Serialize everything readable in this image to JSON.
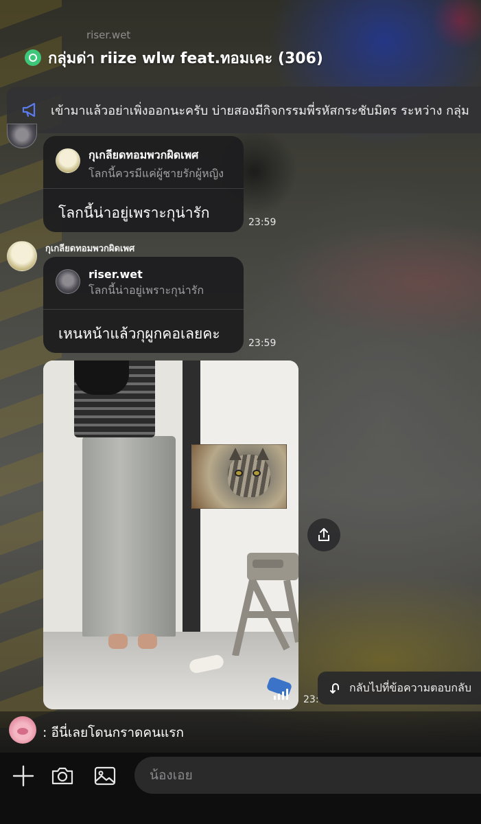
{
  "top_sender": "riser.wet",
  "header": {
    "title": "กลุ่มด่า riize wlw feat.ทอมเคะ (306)"
  },
  "announcement": {
    "text": "เข้ามาแล้วอย่าเพิ่งออกนะครับ บ่ายสองมีกิจกรรมพี่รหัสกระชับมิตร ระหว่าง กลุ่ม"
  },
  "messages": [
    {
      "reply_name": "กุเกลียดทอมพวกผิดเพศ",
      "reply_text": "โลกนี้ควรมีแค่ผู้ชายรักผู้หญิง",
      "text": "โลกนี้น่าอยู่เพราะกุน่ารัก",
      "time": "23:59"
    },
    {
      "sender": "กุเกลียดทอมพวกผิดเพศ",
      "reply_name": "riser.wet",
      "reply_text": "โลกนี้น่าอยู่เพราะกุน่ารัก",
      "text": "เหนหน้าแล้วกุผูกคอเลยคะ",
      "time": "23:59"
    }
  ],
  "media_time": "23:",
  "back_to_reply": {
    "label": "กลับไปที่ข้อความตอบกลับ"
  },
  "preview": {
    "text": ": อีนี่เลยโดนกราดคนแรก"
  },
  "input": {
    "placeholder": "น้องเอย"
  },
  "colors": {
    "group_icon": "#3ec67a",
    "announcement_icon": "#5b7cf0",
    "bubble": "#1e1e20"
  }
}
